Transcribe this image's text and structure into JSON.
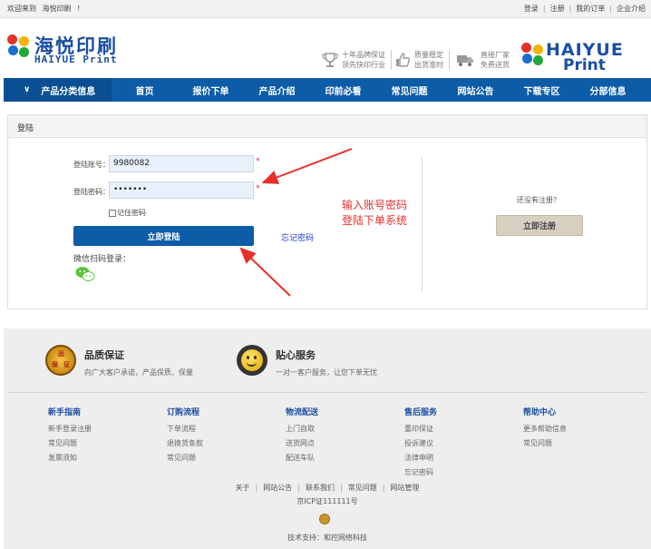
{
  "topbar": {
    "welcome": "欢迎来到",
    "site": "海悦印刷",
    "mark": "!",
    "links": [
      "登录",
      "注册",
      "我的订单",
      "企业介绍"
    ]
  },
  "header": {
    "logo_cn": "海悦印刷",
    "logo_en": "HAIYUE Print",
    "features": [
      {
        "icon": "trophy-icon",
        "line1": "十年品牌保证",
        "line2": "领先快印行业"
      },
      {
        "icon": "thumbs-up-icon",
        "line1": "质量稳定",
        "line2": "出货准时"
      },
      {
        "icon": "truck-icon",
        "line1": "直接厂家",
        "line2": "免费送货"
      }
    ],
    "logo2_line1": "HAIYUE",
    "logo2_line2": "Print"
  },
  "nav": {
    "category": "产品分类信息",
    "items": [
      "首页",
      "报价下单",
      "产品介绍",
      "印前必看",
      "常见问题",
      "网站公告",
      "下载专区",
      "分部信息"
    ]
  },
  "login": {
    "box_title": "登陆",
    "account_label": "登陆账号：",
    "account_value": "9980082",
    "password_label": "登陆密码：",
    "password_value": "•••••••",
    "required_mark": "*",
    "remember_label": "记住密码",
    "login_button": "立即登陆",
    "forgot_link": "忘记密码",
    "wechat_label": "微信扫码登录：",
    "no_account": "还没有注册？",
    "register_button": "立即注册",
    "annotation_line1": "输入账号密码",
    "annotation_line2": "登陆下单系统"
  },
  "footer": {
    "services": [
      {
        "title": "品质保证",
        "desc": "向广大客户承诺，产品保质、保量",
        "badge_text": [
          "品",
          "保",
          "证"
        ]
      },
      {
        "title": "贴心服务",
        "desc": "一对一客户服务，让您下单无忧"
      }
    ],
    "columns": [
      {
        "title": "新手指南",
        "items": [
          "新手登录注册",
          "常见问题",
          "发票须知"
        ]
      },
      {
        "title": "订购流程",
        "items": [
          "下单流程",
          "退换货条款",
          "常见问题"
        ]
      },
      {
        "title": "物流配送",
        "items": [
          "上门自取",
          "送货网点",
          "配送车队"
        ]
      },
      {
        "title": "售后服务",
        "items": [
          "重印保证",
          "投诉建议",
          "法律申明",
          "忘记密码"
        ]
      },
      {
        "title": "帮助中心",
        "items": [
          "更多帮助信息",
          "常见问题"
        ]
      }
    ],
    "links": [
      "关于",
      "网站公告",
      "联系我们",
      "常见问题",
      "网站管理"
    ],
    "icp": "京ICP证111111号",
    "tech": "技术支持：和控网络科技"
  },
  "colors": {
    "nav_blue": "#0d5ca8",
    "brand_blue": "#1b4fa3",
    "annotation_red": "#e6302a"
  }
}
